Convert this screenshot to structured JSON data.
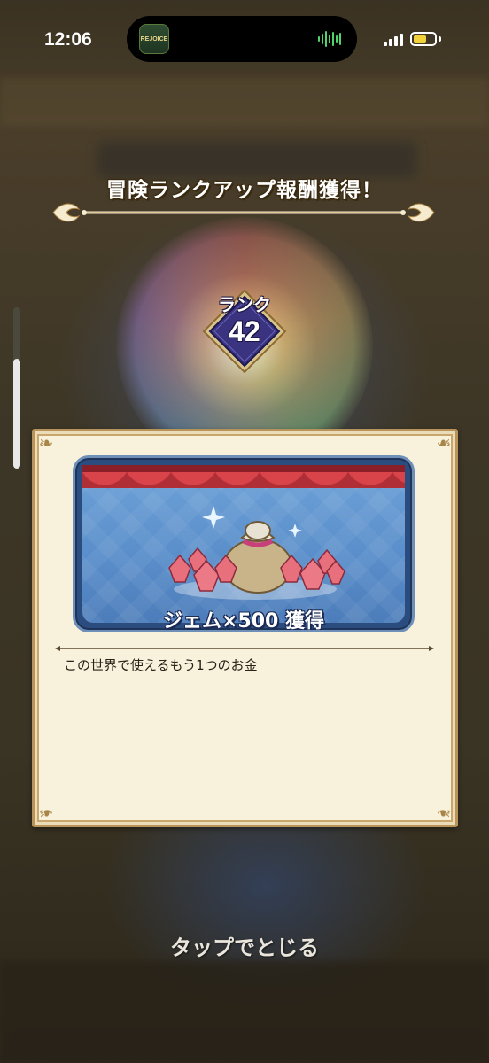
{
  "status_bar": {
    "time": "12:06",
    "island_app_label": "REJOICE",
    "battery_color": "#f2d23a"
  },
  "dialog": {
    "title": "冒険ランクアップ報酬獲得！",
    "rank": {
      "label": "ランク",
      "value": "42"
    },
    "reward": {
      "text": "ジェム×500 獲得",
      "icon": "gem-bag-icon"
    },
    "description": "この世界で使えるもう1つのお金",
    "close_hint": "タップでとじる"
  },
  "colors": {
    "panel_background": "#f8f1dc",
    "panel_border": "#b8935a",
    "card_background": "#5b8fcb",
    "curtain": "#d9434a",
    "rank_diamond": "#3a3380",
    "gem": "#e8707c"
  }
}
